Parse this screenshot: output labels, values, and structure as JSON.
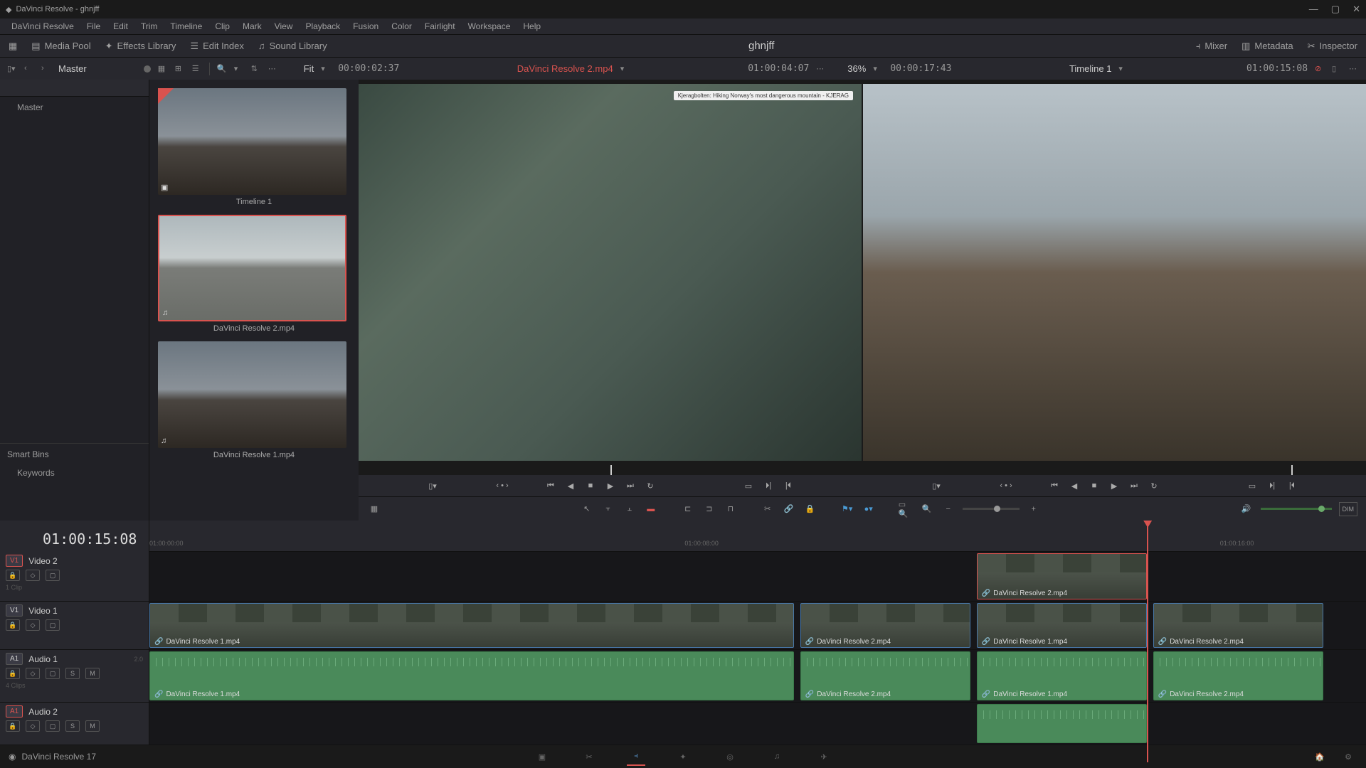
{
  "title": "DaVinci Resolve - ghnjff",
  "menus": [
    "DaVinci Resolve",
    "File",
    "Edit",
    "Trim",
    "Timeline",
    "Clip",
    "Mark",
    "View",
    "Playback",
    "Fusion",
    "Color",
    "Fairlight",
    "Workspace",
    "Help"
  ],
  "toolbar": {
    "media_pool": "Media Pool",
    "effects": "Effects Library",
    "edit_index": "Edit Index",
    "sound": "Sound Library",
    "mixer": "Mixer",
    "metadata": "Metadata",
    "inspector": "Inspector"
  },
  "project": "ghnjff",
  "subbar": {
    "master": "Master",
    "fit": "Fit",
    "src_tc": "00:00:02:37",
    "src_clip": "DaVinci Resolve 2.mp4",
    "src_dur": "01:00:04:07",
    "zoom": "36%",
    "tl_pos": "00:00:17:43",
    "tl_name": "Timeline 1",
    "tl_dur": "01:00:15:08"
  },
  "sidebar": {
    "root": "Master",
    "smartbins": "Smart Bins",
    "keywords": "Keywords"
  },
  "clips": [
    {
      "label": "Timeline 1",
      "sel": false,
      "type": "tl"
    },
    {
      "label": "DaVinci Resolve 2.mp4",
      "sel": true,
      "type": "water"
    },
    {
      "label": "DaVinci Resolve 1.mp4",
      "sel": false,
      "type": "road"
    }
  ],
  "viewer_watermark": "Kjeragbolten: Hiking Norway's most dangerous mountain - KJERAG",
  "timeline": {
    "tc": "01:00:15:08",
    "ruler": [
      "01:00:00:00",
      "01:00:08:00",
      "01:00:16:00"
    ],
    "tracks": [
      {
        "id": "V1",
        "label": "Video 2",
        "type": "v",
        "info": "1 Clip",
        "badge_red": true
      },
      {
        "id": "V1",
        "label": "Video 1",
        "type": "v",
        "info": "",
        "badge_red": false
      },
      {
        "id": "A1",
        "label": "Audio 1",
        "type": "a",
        "info": "4 Clips",
        "ch": "2.0",
        "badge_red": false
      },
      {
        "id": "A1",
        "label": "Audio 2",
        "type": "a",
        "info": "",
        "ch": "",
        "badge_red": true
      }
    ],
    "clips_v2": [
      {
        "label": "DaVinci Resolve 2.mp4",
        "l": 68,
        "w": 14,
        "sel": true
      }
    ],
    "clips_v1": [
      {
        "label": "DaVinci Resolve 1.mp4",
        "l": 0,
        "w": 53
      },
      {
        "label": "DaVinci Resolve 2.mp4",
        "l": 53.5,
        "w": 14
      },
      {
        "label": "DaVinci Resolve 1.mp4",
        "l": 68,
        "w": 14
      },
      {
        "label": "DaVinci Resolve 2.mp4",
        "l": 82.5,
        "w": 14
      }
    ],
    "clips_a1": [
      {
        "label": "DaVinci Resolve 1.mp4",
        "l": 0,
        "w": 53
      },
      {
        "label": "DaVinci Resolve 2.mp4",
        "l": 53.5,
        "w": 14
      },
      {
        "label": "DaVinci Resolve 1.mp4",
        "l": 68,
        "w": 14
      },
      {
        "label": "DaVinci Resolve 2.mp4",
        "l": 82.5,
        "w": 14
      }
    ],
    "clips_a2": [
      {
        "label": "",
        "l": 68,
        "w": 14
      }
    ],
    "playhead_pct": 82
  },
  "app": "DaVinci Resolve 17",
  "dim": "DIM"
}
